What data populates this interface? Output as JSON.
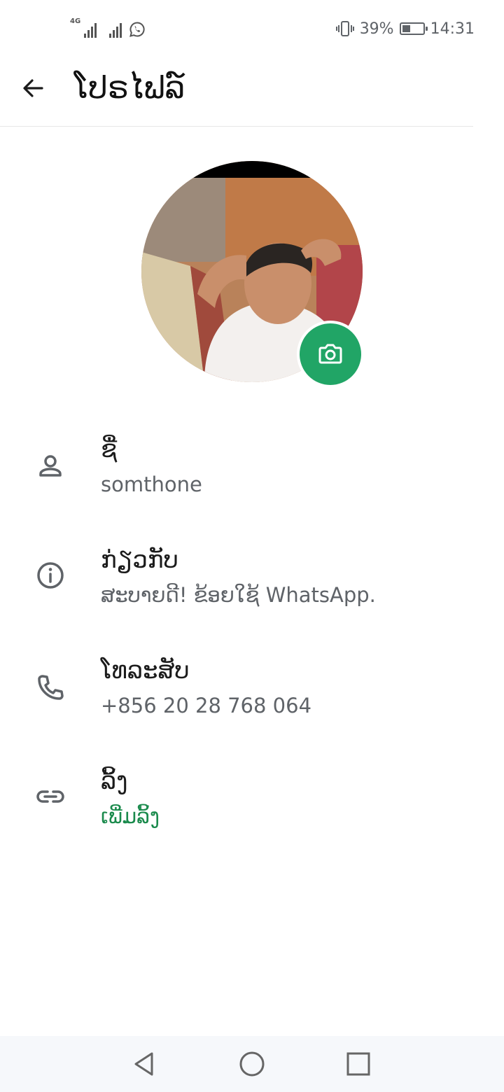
{
  "status_bar": {
    "network_type": "4G",
    "battery_percent_text": "39%",
    "battery_level": 0.39,
    "time": "14:31",
    "icons": [
      "signal-4g-icon",
      "signal-icon",
      "whatsapp-icon",
      "vibrate-icon",
      "battery-icon"
    ]
  },
  "app_bar": {
    "title": "ໂປຣໄຟລ໌",
    "back_icon": "arrow-left-icon"
  },
  "profile": {
    "avatar_icon": "profile-photo",
    "camera_icon": "camera-icon",
    "accent_color": "#21a566"
  },
  "fields": [
    {
      "icon": "person-icon",
      "label": "ຊື່",
      "value": "somthone"
    },
    {
      "icon": "info-icon",
      "label": "ກ່ຽວກັບ",
      "value": "ສະບາຍດີ! ຂ້ອຍໃຊ້ WhatsApp."
    },
    {
      "icon": "phone-icon",
      "label": "ໂທລະສັບ",
      "value": "+856 20 28 768 064"
    },
    {
      "icon": "link-icon",
      "label": "ລິ້ງ",
      "value": "ເພີ່ມລິ້ງ",
      "value_color": "#1a8a4c"
    }
  ],
  "nav_bar": {
    "buttons": [
      "nav-back-icon",
      "nav-home-icon",
      "nav-recents-icon"
    ]
  }
}
